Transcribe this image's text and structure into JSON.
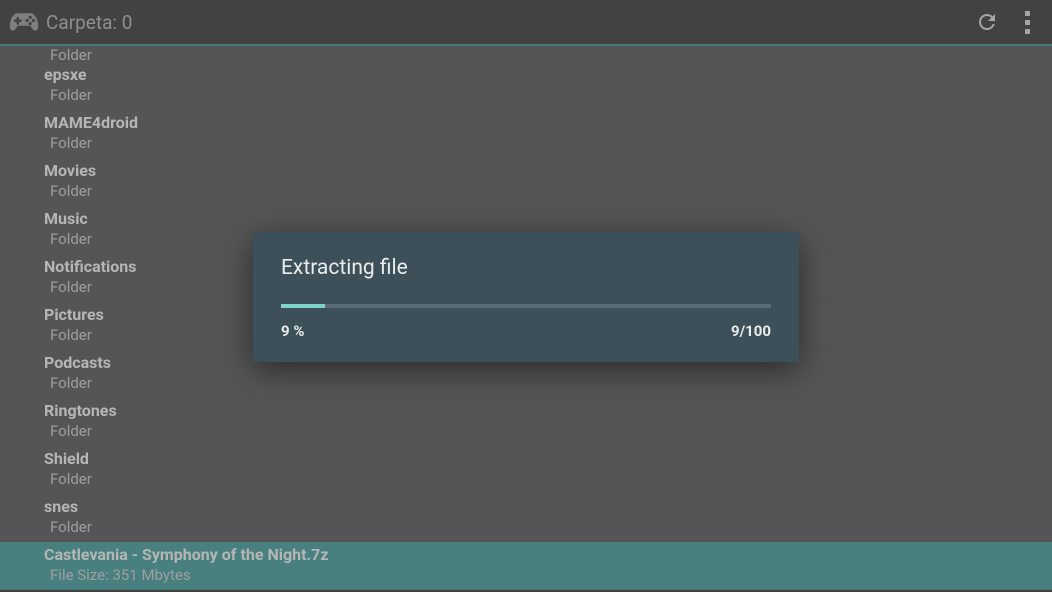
{
  "actionBar": {
    "title": "Carpeta: 0"
  },
  "list": {
    "items": [
      {
        "name": "",
        "subtitle": "Folder",
        "selected": false,
        "partial": true
      },
      {
        "name": "epsxe",
        "subtitle": "Folder",
        "selected": false
      },
      {
        "name": "MAME4droid",
        "subtitle": "Folder",
        "selected": false
      },
      {
        "name": "Movies",
        "subtitle": "Folder",
        "selected": false
      },
      {
        "name": "Music",
        "subtitle": "Folder",
        "selected": false
      },
      {
        "name": "Notifications",
        "subtitle": "Folder",
        "selected": false
      },
      {
        "name": "Pictures",
        "subtitle": "Folder",
        "selected": false
      },
      {
        "name": "Podcasts",
        "subtitle": "Folder",
        "selected": false
      },
      {
        "name": "Ringtones",
        "subtitle": "Folder",
        "selected": false
      },
      {
        "name": "Shield",
        "subtitle": "Folder",
        "selected": false
      },
      {
        "name": "snes",
        "subtitle": "Folder",
        "selected": false
      },
      {
        "name": "Castlevania - Symphony of the Night.7z",
        "subtitle": "File Size: 351 Mbytes",
        "selected": true
      }
    ]
  },
  "dialog": {
    "title": "Extracting file",
    "percent": 9,
    "percentLabel": "9 %",
    "countLabel": "9/100"
  }
}
